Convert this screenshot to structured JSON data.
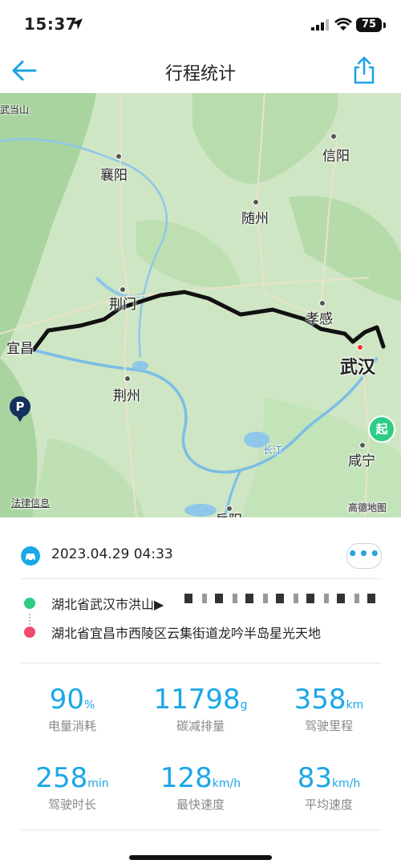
{
  "status_bar": {
    "time": "15:37",
    "battery": "75"
  },
  "nav": {
    "title": "行程统计"
  },
  "map": {
    "cities": {
      "wudangshan": "武当山",
      "xiangyang": "襄阳",
      "xinyang": "信阳",
      "suizhou": "随州",
      "jingmen": "荆门",
      "xiaogan": "孝感",
      "yichang": "宜昌",
      "wuhan": "武汉",
      "jingzhou": "荆州",
      "xianning": "咸宁",
      "changjiang": "长江",
      "yueyang": "岳阳"
    },
    "start_marker": "起",
    "end_marker": "P",
    "legal_link": "法律信息",
    "provider_logo": "高德地图",
    "route_color": "#111111"
  },
  "trip": {
    "datetime": "2023.04.29 04:33",
    "more_label": "•••",
    "start_address": "湖北省武汉市洪山▶",
    "end_address": "湖北省宜昌市西陵区云集街道龙吟半岛星光天地",
    "start_color": "#2ecc85",
    "end_color": "#ef4d6b"
  },
  "stats": [
    {
      "value": "90",
      "unit": "%",
      "label": "电量消耗"
    },
    {
      "value": "11798",
      "unit": "g",
      "label": "碳减排量"
    },
    {
      "value": "358",
      "unit": "km",
      "label": "驾驶里程"
    },
    {
      "value": "258",
      "unit": "min",
      "label": "驾驶时长"
    },
    {
      "value": "128",
      "unit": "km/h",
      "label": "最快速度"
    },
    {
      "value": "83",
      "unit": "km/h",
      "label": "平均速度"
    }
  ]
}
